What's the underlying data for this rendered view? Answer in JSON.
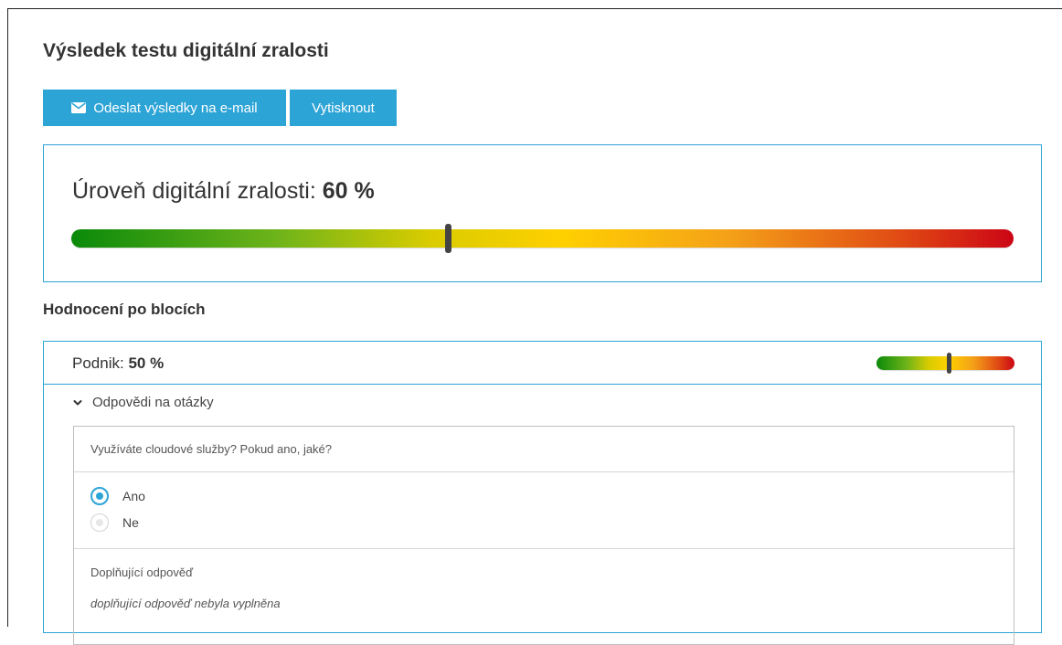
{
  "page": {
    "title": "Výsledek testu digitální zralosti"
  },
  "toolbar": {
    "email_label": "Odeslat výsledky na e-mail",
    "email_icon": "envelope-icon",
    "print_label": "Vytisknout",
    "accent_color": "#2da4d6"
  },
  "overall": {
    "label": "Úroveň digitální zralosti:",
    "value": "60 %",
    "gauge_fraction": 0.4
  },
  "blocks_section": {
    "title": "Hodnocení po blocích"
  },
  "blocks": [
    {
      "label": "Podnik:",
      "value": "50 %",
      "gauge_fraction": 0.52,
      "answers_toggle": "Odpovědi na otázky",
      "toggle_icon": "chevron-down-icon",
      "question": {
        "text": "Využíváte cloudové služby? Pokud ano, jaké?",
        "options": [
          {
            "label": "Ano",
            "selected": true
          },
          {
            "label": "Ne",
            "selected": false
          }
        ],
        "extra_label": "Doplňující odpověď",
        "extra_value": "doplňující odpověď nebyla vyplněna"
      }
    }
  ]
}
